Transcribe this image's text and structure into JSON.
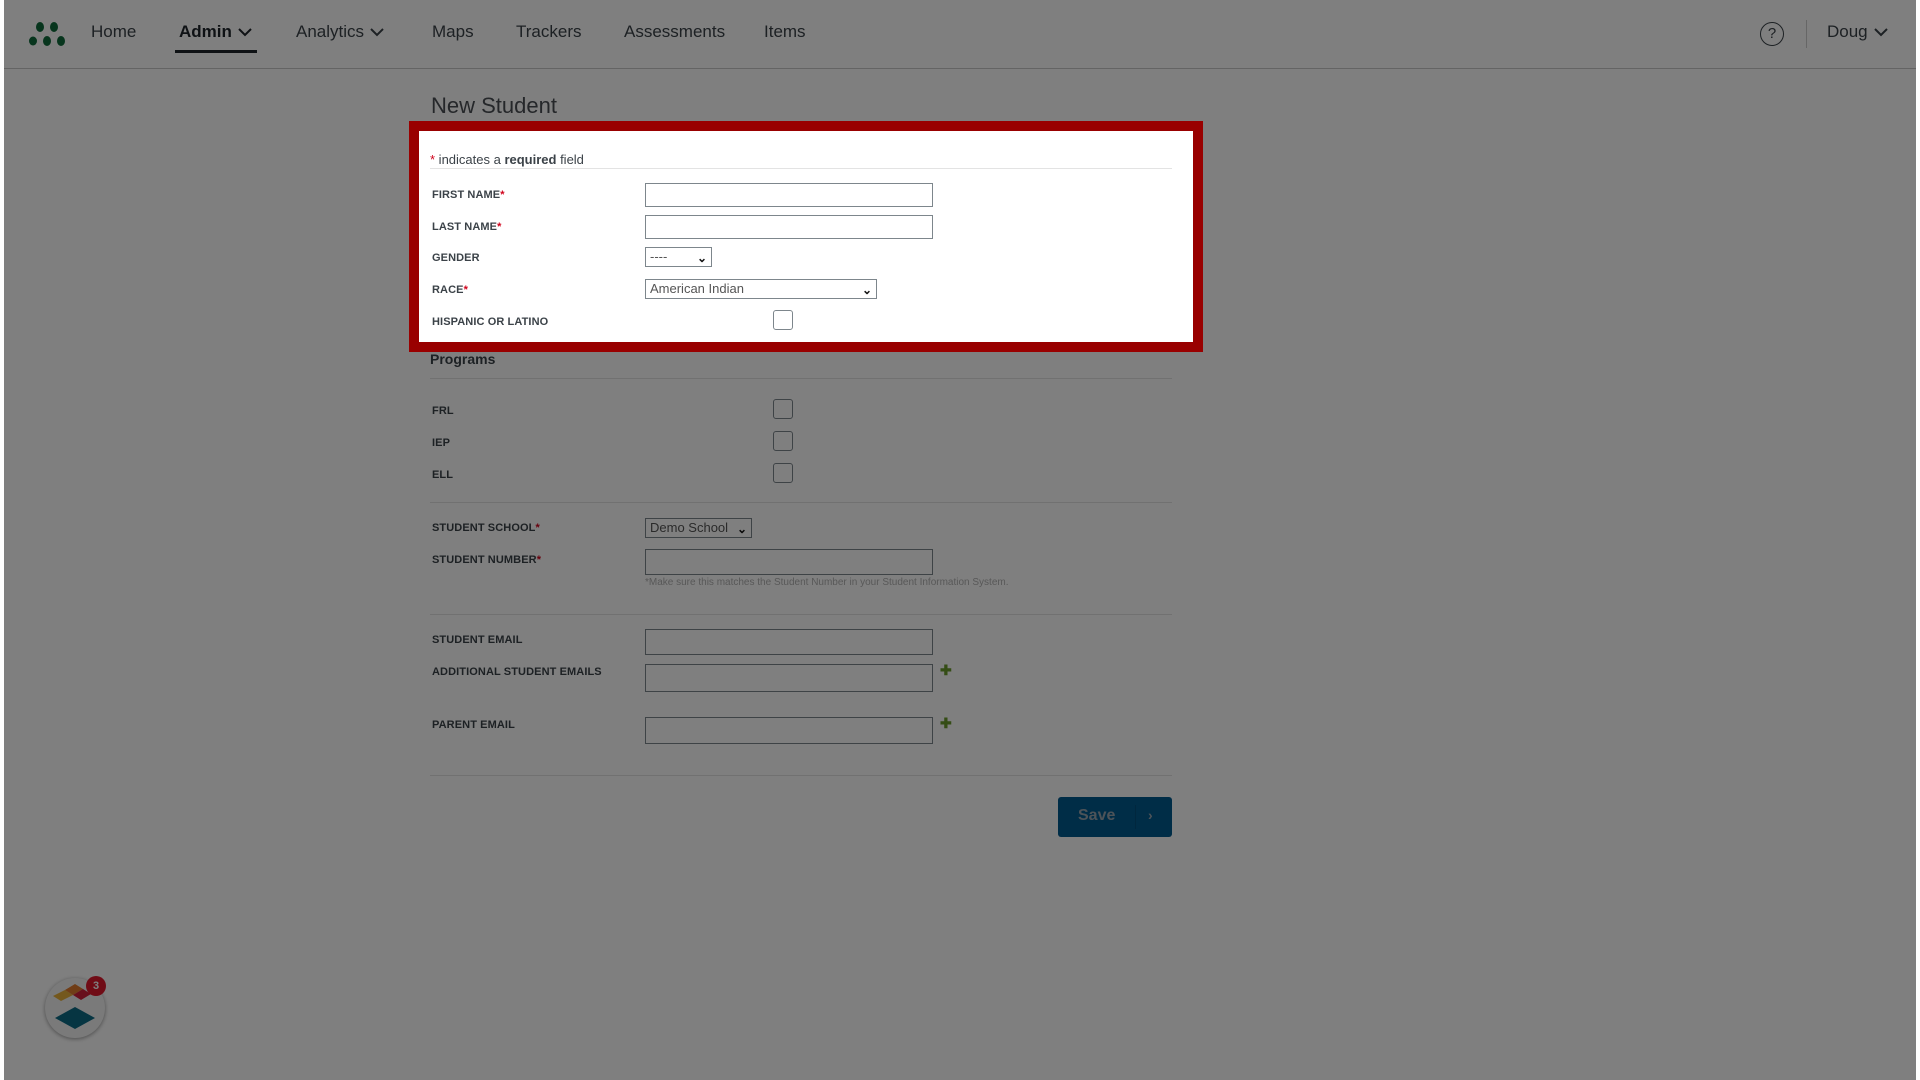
{
  "header": {
    "nav": [
      {
        "label": "Home",
        "active": false,
        "dropdown": false
      },
      {
        "label": "Admin",
        "active": true,
        "dropdown": true
      },
      {
        "label": "Analytics",
        "active": false,
        "dropdown": true
      },
      {
        "label": "Maps",
        "active": false,
        "dropdown": false
      },
      {
        "label": "Trackers",
        "active": false,
        "dropdown": false
      },
      {
        "label": "Assessments",
        "active": false,
        "dropdown": false
      },
      {
        "label": "Items",
        "active": false,
        "dropdown": false
      }
    ],
    "help_icon": "question-circle-icon",
    "help_glyph": "?",
    "user_name": "Doug"
  },
  "page": {
    "title": "New Student",
    "required_note": {
      "star": "*",
      "pre": " indicates a ",
      "bold": "required",
      "post": " field"
    },
    "fields": {
      "first_name": {
        "label": "FIRST NAME",
        "required": "*",
        "value": ""
      },
      "last_name": {
        "label": "LAST NAME",
        "required": "*",
        "value": ""
      },
      "gender": {
        "label": "GENDER",
        "selected": "----"
      },
      "race": {
        "label": "RACE",
        "required": "*",
        "selected": "American Indian"
      },
      "hispanic": {
        "label": "HISPANIC OR LATINO",
        "checked": false
      }
    },
    "programs": {
      "heading": "Programs",
      "items": [
        {
          "label": "FRL",
          "checked": false
        },
        {
          "label": "IEP",
          "checked": false
        },
        {
          "label": "ELL",
          "checked": false
        }
      ]
    },
    "school": {
      "label": "STUDENT SCHOOL",
      "required": "*",
      "selected": "Demo School"
    },
    "student_number": {
      "label": "STUDENT NUMBER",
      "required": "*",
      "value": "",
      "hint": "*Make sure this matches the Student Number in your Student Information System."
    },
    "student_email": {
      "label": "STUDENT EMAIL",
      "value": ""
    },
    "additional_emails": {
      "label": "ADDITIONAL STUDENT EMAILS",
      "value": ""
    },
    "parent_email": {
      "label": "PARENT EMAIL",
      "value": ""
    },
    "add_glyph": "✚",
    "save_label": "Save",
    "save_arrow": "›"
  },
  "widget": {
    "badge_count": "3"
  },
  "colors": {
    "highlight": "#990000",
    "required": "#d0021b",
    "save": "#005a8f",
    "add": "#6a9a2c"
  }
}
